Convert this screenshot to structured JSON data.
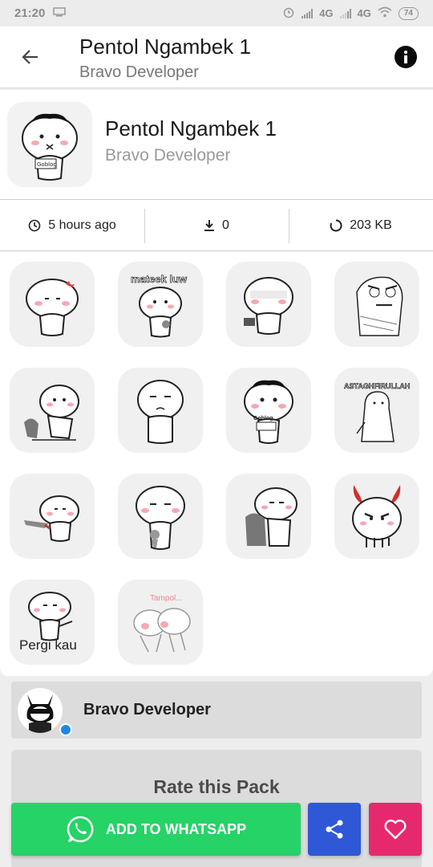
{
  "status_bar": {
    "time": "21:20",
    "net1": "4G",
    "net2": "4G",
    "battery": "74"
  },
  "app_bar": {
    "title": "Pentol Ngambek 1",
    "subtitle": "Bravo Developer"
  },
  "pack": {
    "title": "Pentol Ngambek 1",
    "author": "Bravo Developer",
    "tray_caption": "Goblog",
    "updated": "5 hours ago",
    "downloads": "0",
    "size": "203 KB"
  },
  "stickers": [
    {
      "caption": ""
    },
    {
      "caption": "mateek luw"
    },
    {
      "caption": ""
    },
    {
      "caption": ""
    },
    {
      "caption": ""
    },
    {
      "caption": ""
    },
    {
      "caption": "Goblog"
    },
    {
      "caption": "ASTAGHFIRULLAH"
    },
    {
      "caption": ""
    },
    {
      "caption": ""
    },
    {
      "caption": ""
    },
    {
      "caption": ""
    },
    {
      "caption": "Pergi kau"
    },
    {
      "caption": "Tampol..."
    }
  ],
  "author_card": {
    "name": "Bravo Developer"
  },
  "rate": {
    "label": "Rate this Pack"
  },
  "actions": {
    "add_label": "ADD TO WHATSAPP"
  },
  "colors": {
    "whatsapp": "#25d366",
    "share": "#2e58d6",
    "favorite": "#e6296f"
  },
  "icons": [
    "back-arrow-icon",
    "info-icon",
    "clock-icon",
    "download-icon",
    "size-icon",
    "whatsapp-icon",
    "share-icon",
    "heart-icon"
  ]
}
